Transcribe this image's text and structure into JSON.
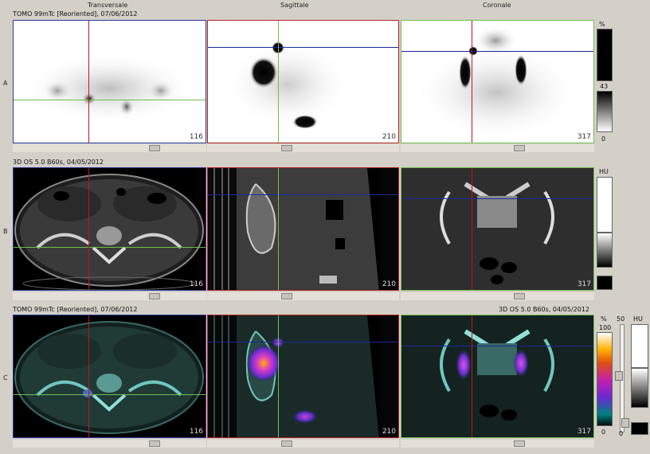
{
  "headers": {
    "transversale": "Transversale",
    "sagittale": "Sagittale",
    "coronale": "Coronale"
  },
  "rows": {
    "a": {
      "label": "A",
      "title": "TOMO 99mTc [Reoriented], 07/06/2012"
    },
    "b": {
      "label": "B",
      "title": "3D OS 5.0 B60s, 04/05/2012"
    },
    "c": {
      "label": "C",
      "title_left": "TOMO 99mTc [Reoriented], 07/06/2012",
      "title_right": "3D OS 5.0 B60s, 04/05/2012"
    }
  },
  "slices": {
    "transversale": "116",
    "sagittale": "210",
    "coronale": "317"
  },
  "scale_a": {
    "unit": "%",
    "value": "43",
    "min": "0"
  },
  "scale_b": {
    "unit": "HU"
  },
  "scale_c": {
    "unit_left": "%",
    "max_left": "100",
    "min_left": "0",
    "slider_value": "50",
    "unit_right": "HU",
    "slider_min": "0"
  },
  "colors": {
    "crosshair_horizontal_transverse": "#6fbf4f",
    "crosshair_vertical": "#c01818",
    "crosshair_horizontal": "#1a2a9a",
    "crosshair_green_vertical": "#6fbf4f"
  }
}
